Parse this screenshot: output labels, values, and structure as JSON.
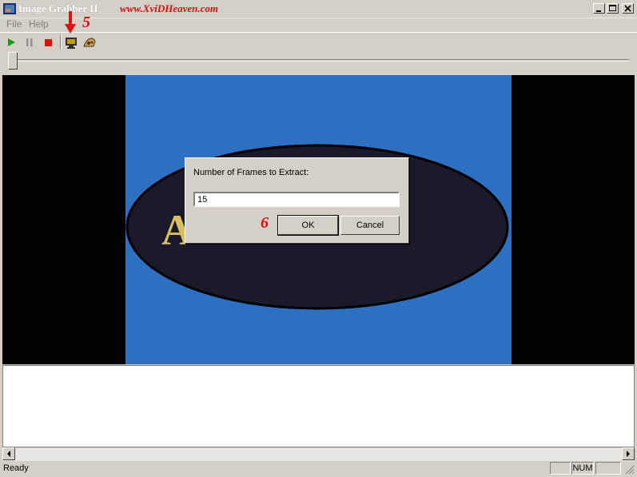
{
  "window": {
    "title": "Image Grabber II",
    "watermark": "www.XviDHeaven.com"
  },
  "menu": {
    "items": [
      {
        "label": "File"
      },
      {
        "label": "Help"
      }
    ]
  },
  "toolbar": {
    "buttons": [
      "play-icon",
      "pause-icon",
      "stop-icon",
      "grab-frames-icon",
      "settings-icon"
    ]
  },
  "annotations": {
    "step5": "5",
    "step6": "6"
  },
  "slider": {
    "position": 0.0
  },
  "video": {
    "frame_text": "AL   DE"
  },
  "dialog": {
    "prompt": "Number of Frames to Extract:",
    "input_value": "15",
    "ok_label": "OK",
    "cancel_label": "Cancel"
  },
  "status": {
    "text": "Ready",
    "num_indicator": "NUM"
  },
  "colors": {
    "annotation_red": "#d01010",
    "video_blue": "#2d6fc0",
    "chrome": "#d4d0c8"
  }
}
